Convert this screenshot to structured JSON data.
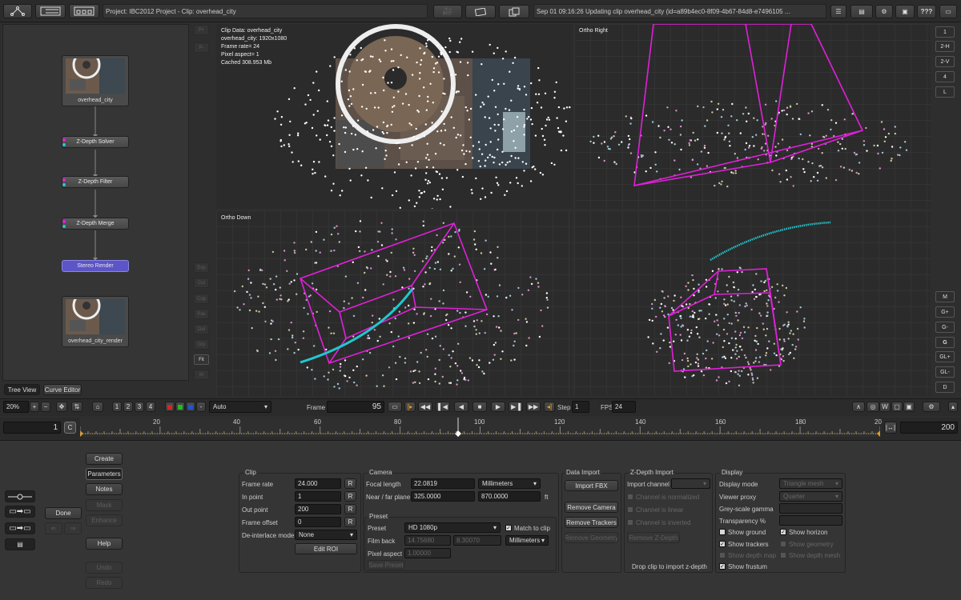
{
  "topbar": {
    "project_info": "Project: IBC2012 Project - Clip: overhead_city",
    "status": "Sep 01 09:16:26 Updating clip overhead_city (id=a89b4ec0-8f09-4b67-84d8-e7496105 ...",
    "help_label": "???"
  },
  "nodes": {
    "input_thumb": "overhead_city",
    "solver": "Z-Depth Solver",
    "filter": "Z-Depth Filter",
    "merge": "Z-Depth Merge",
    "render": "Stereo Render",
    "output_thumb": "overhead_city_render"
  },
  "node_side": [
    "P+",
    "P-"
  ],
  "tools_side": [
    "Exp",
    "Cut",
    "Cop",
    "Pas",
    "Del",
    "Grp",
    "Fit",
    "M"
  ],
  "tabs": {
    "tree": "Tree View",
    "curve": "Curve Editor"
  },
  "viewports": {
    "main_info": [
      "Clip Data: overhead_city",
      "overhead_city: 1920x1080",
      "Frame rate= 24",
      "Pixel aspect= 1",
      "Cached 308.953 Mb"
    ],
    "ortho_right": "Ortho Right",
    "ortho_down": "Ortho Down"
  },
  "view_buttons": [
    "1",
    "2-H",
    "2-V",
    "4",
    "L"
  ],
  "gl_buttons": [
    "M",
    "G+",
    "G-",
    "G",
    "GL+",
    "GL-",
    "D"
  ],
  "transport": {
    "zoom": "20%",
    "pages": [
      "1",
      "2",
      "3",
      "4"
    ],
    "auto": "Auto",
    "frame_label": "Frame",
    "frame": "95",
    "step_label": "Step",
    "step": "1",
    "fps_label": "FPS",
    "fps": "24"
  },
  "timeline": {
    "start": "1",
    "c": "C",
    "end": "200",
    "ticks": [
      "20",
      "40",
      "60",
      "80",
      "100",
      "120",
      "140",
      "160",
      "180",
      "20"
    ]
  },
  "actions": {
    "create": "Create",
    "parameters": "Parameters",
    "notes": "Notes",
    "mask": "Mask",
    "enhance": "Enhance",
    "done": "Done",
    "help": "Help",
    "undo": "Undo",
    "redo": "Redo"
  },
  "clip": {
    "title": "Clip",
    "frame_rate_label": "Frame rate",
    "frame_rate": "24.000",
    "in_label": "In point",
    "in": "1",
    "out_label": "Out point",
    "out": "200",
    "offset_label": "Frame offset",
    "offset": "0",
    "deint_label": "De-interlace mode",
    "deint": "None",
    "edit_roi": "Edit ROI",
    "r": "R"
  },
  "camera": {
    "title": "Camera",
    "focal_label": "Focal length",
    "focal": "22.0819",
    "focal_unit": "Millimeters",
    "nf_label": "Near / far plane",
    "near": "325.0000",
    "far": "870.0000",
    "ft": "ft"
  },
  "preset": {
    "title": "Preset",
    "preset_label": "Preset",
    "preset": "HD 1080p",
    "match": "Match to clip",
    "film_label": "Film back",
    "film_w": "14.75680",
    "film_h": "8.30070",
    "film_unit": "Millimeters",
    "aspect_label": "Pixel aspect",
    "aspect": "1.00000",
    "save": "Save Preset"
  },
  "data_import": {
    "title": "Data Import",
    "import_fbx": "Import FBX",
    "remove_camera": "Remove Camera",
    "remove_trackers": "Remove Trackers",
    "remove_geometry": "Remove Geometry"
  },
  "zdepth": {
    "title": "Z-Depth Import",
    "channel_label": "Import channel",
    "normalized": "Channel is normalized",
    "linear": "Channel is linear",
    "inverted": "Channel is inverted",
    "remove": "Remove Z-Depth",
    "drop": "Drop clip to import z-depth"
  },
  "display": {
    "title": "Display",
    "mode_label": "Display mode",
    "mode": "Triangle mesh",
    "proxy_label": "Viewer proxy",
    "proxy": "Quarter",
    "grey_label": "Grey-scale gamma",
    "trans_label": "Transparency %",
    "show_ground": "Show ground",
    "show_horizon": "Show horizon",
    "show_trackers": "Show trackers",
    "show_geometry": "Show geometry",
    "show_depth_map": "Show depth map",
    "show_depth_mesh": "Show depth mesh",
    "show_frustum": "Show frustum"
  },
  "colors": {
    "magenta": "#e020d8",
    "cyan": "#20c8d0",
    "render_node": "#5b55c8"
  }
}
